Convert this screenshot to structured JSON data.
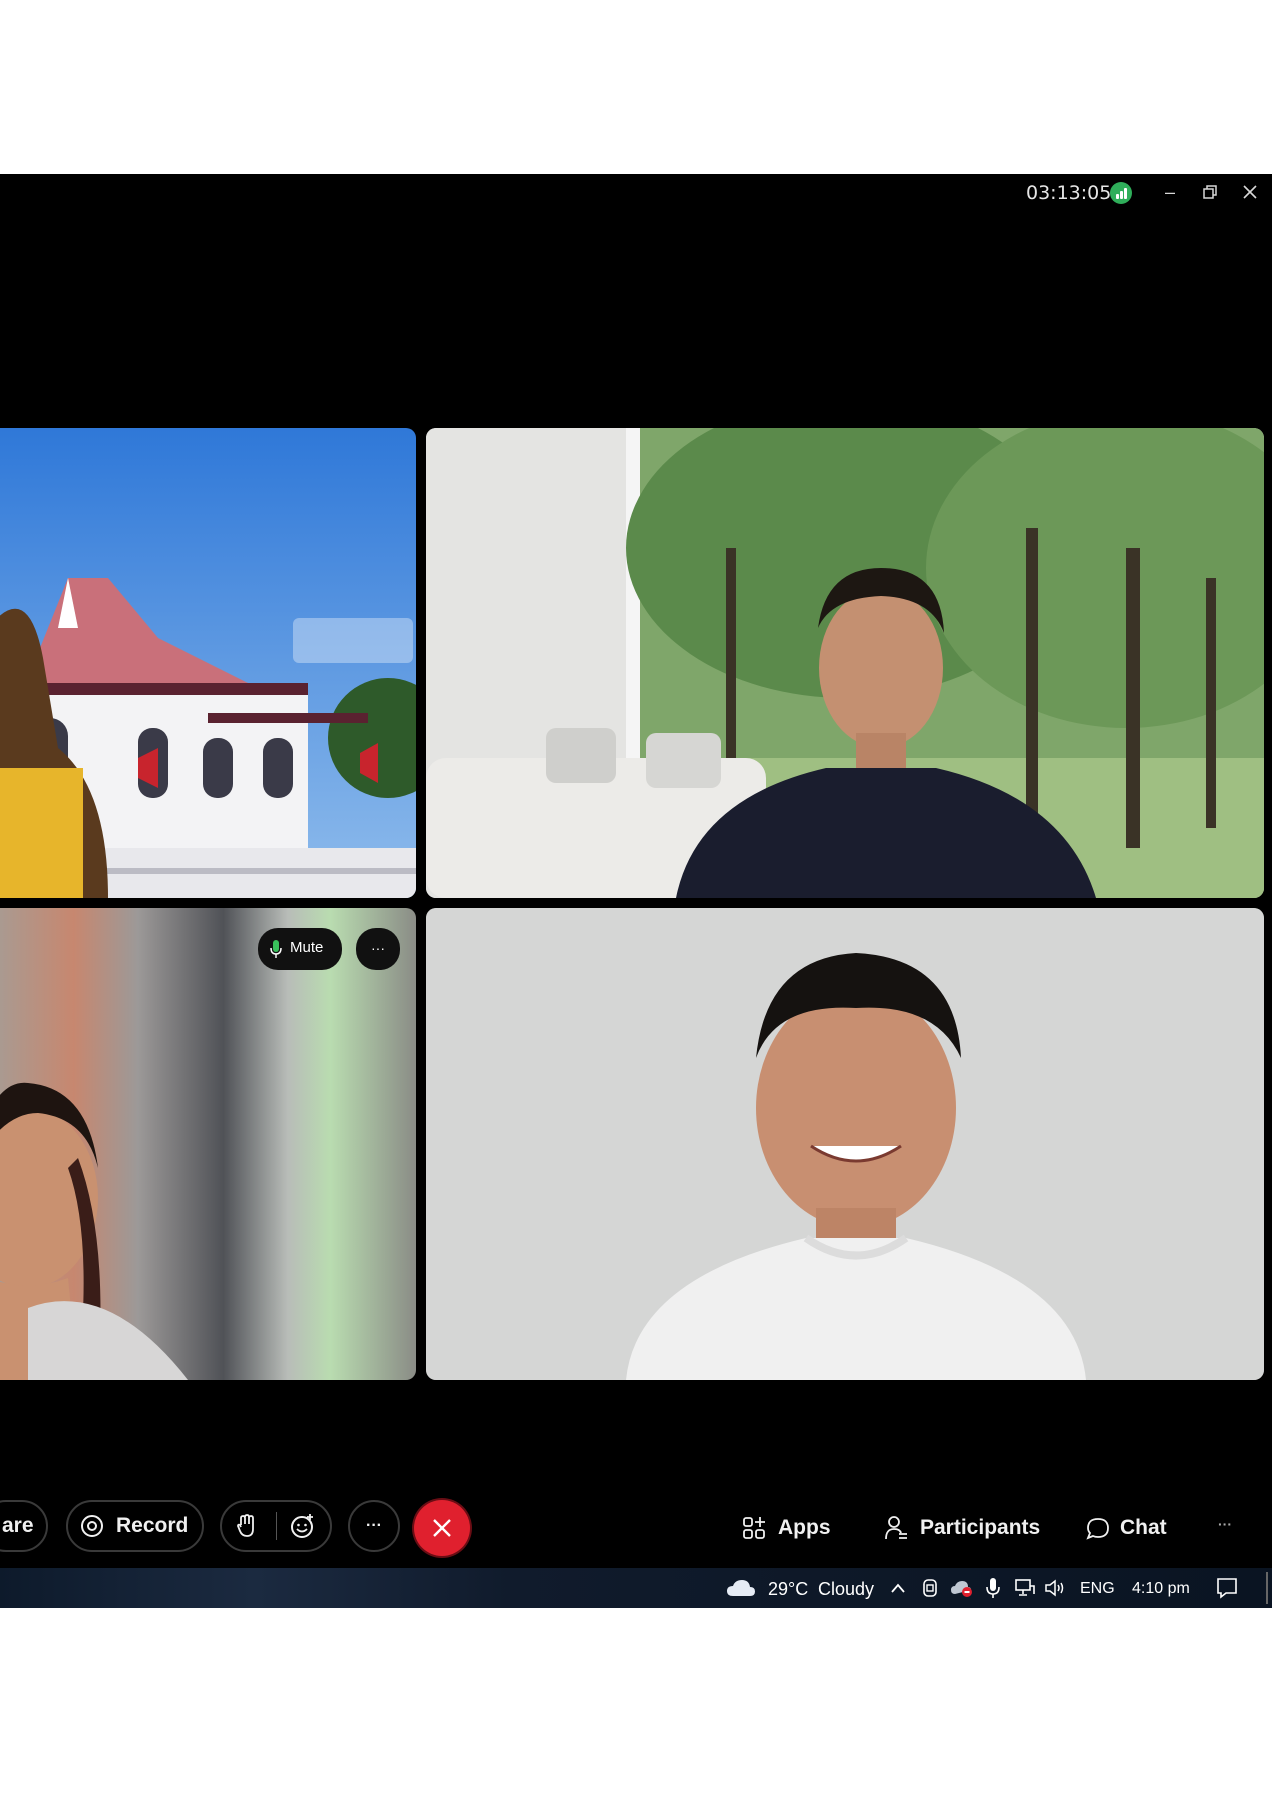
{
  "window": {
    "timer": "03:13:05",
    "controls": [
      "minimize-icon",
      "restore-icon",
      "close-icon"
    ]
  },
  "tiles": [
    {
      "id": "tile-top-left",
      "description_icon": "video-feed"
    },
    {
      "id": "tile-top-right",
      "description_icon": "video-feed"
    },
    {
      "id": "tile-bottom-left",
      "description_icon": "video-feed",
      "overlay": {
        "mute_label": "Mute",
        "more_label": "···"
      }
    },
    {
      "id": "tile-bottom-right",
      "description_icon": "video-feed"
    }
  ],
  "toolbar": {
    "share_label": "are",
    "record_label": "Record",
    "more_label": "···",
    "apps_label": "Apps",
    "participants_label": "Participants",
    "chat_label": "Chat",
    "overflow_label": "···",
    "end_call_color": "#e0202e"
  },
  "taskbar": {
    "temperature": "29°C",
    "weather": "Cloudy",
    "language": "ENG",
    "time": "4:10 pm"
  }
}
